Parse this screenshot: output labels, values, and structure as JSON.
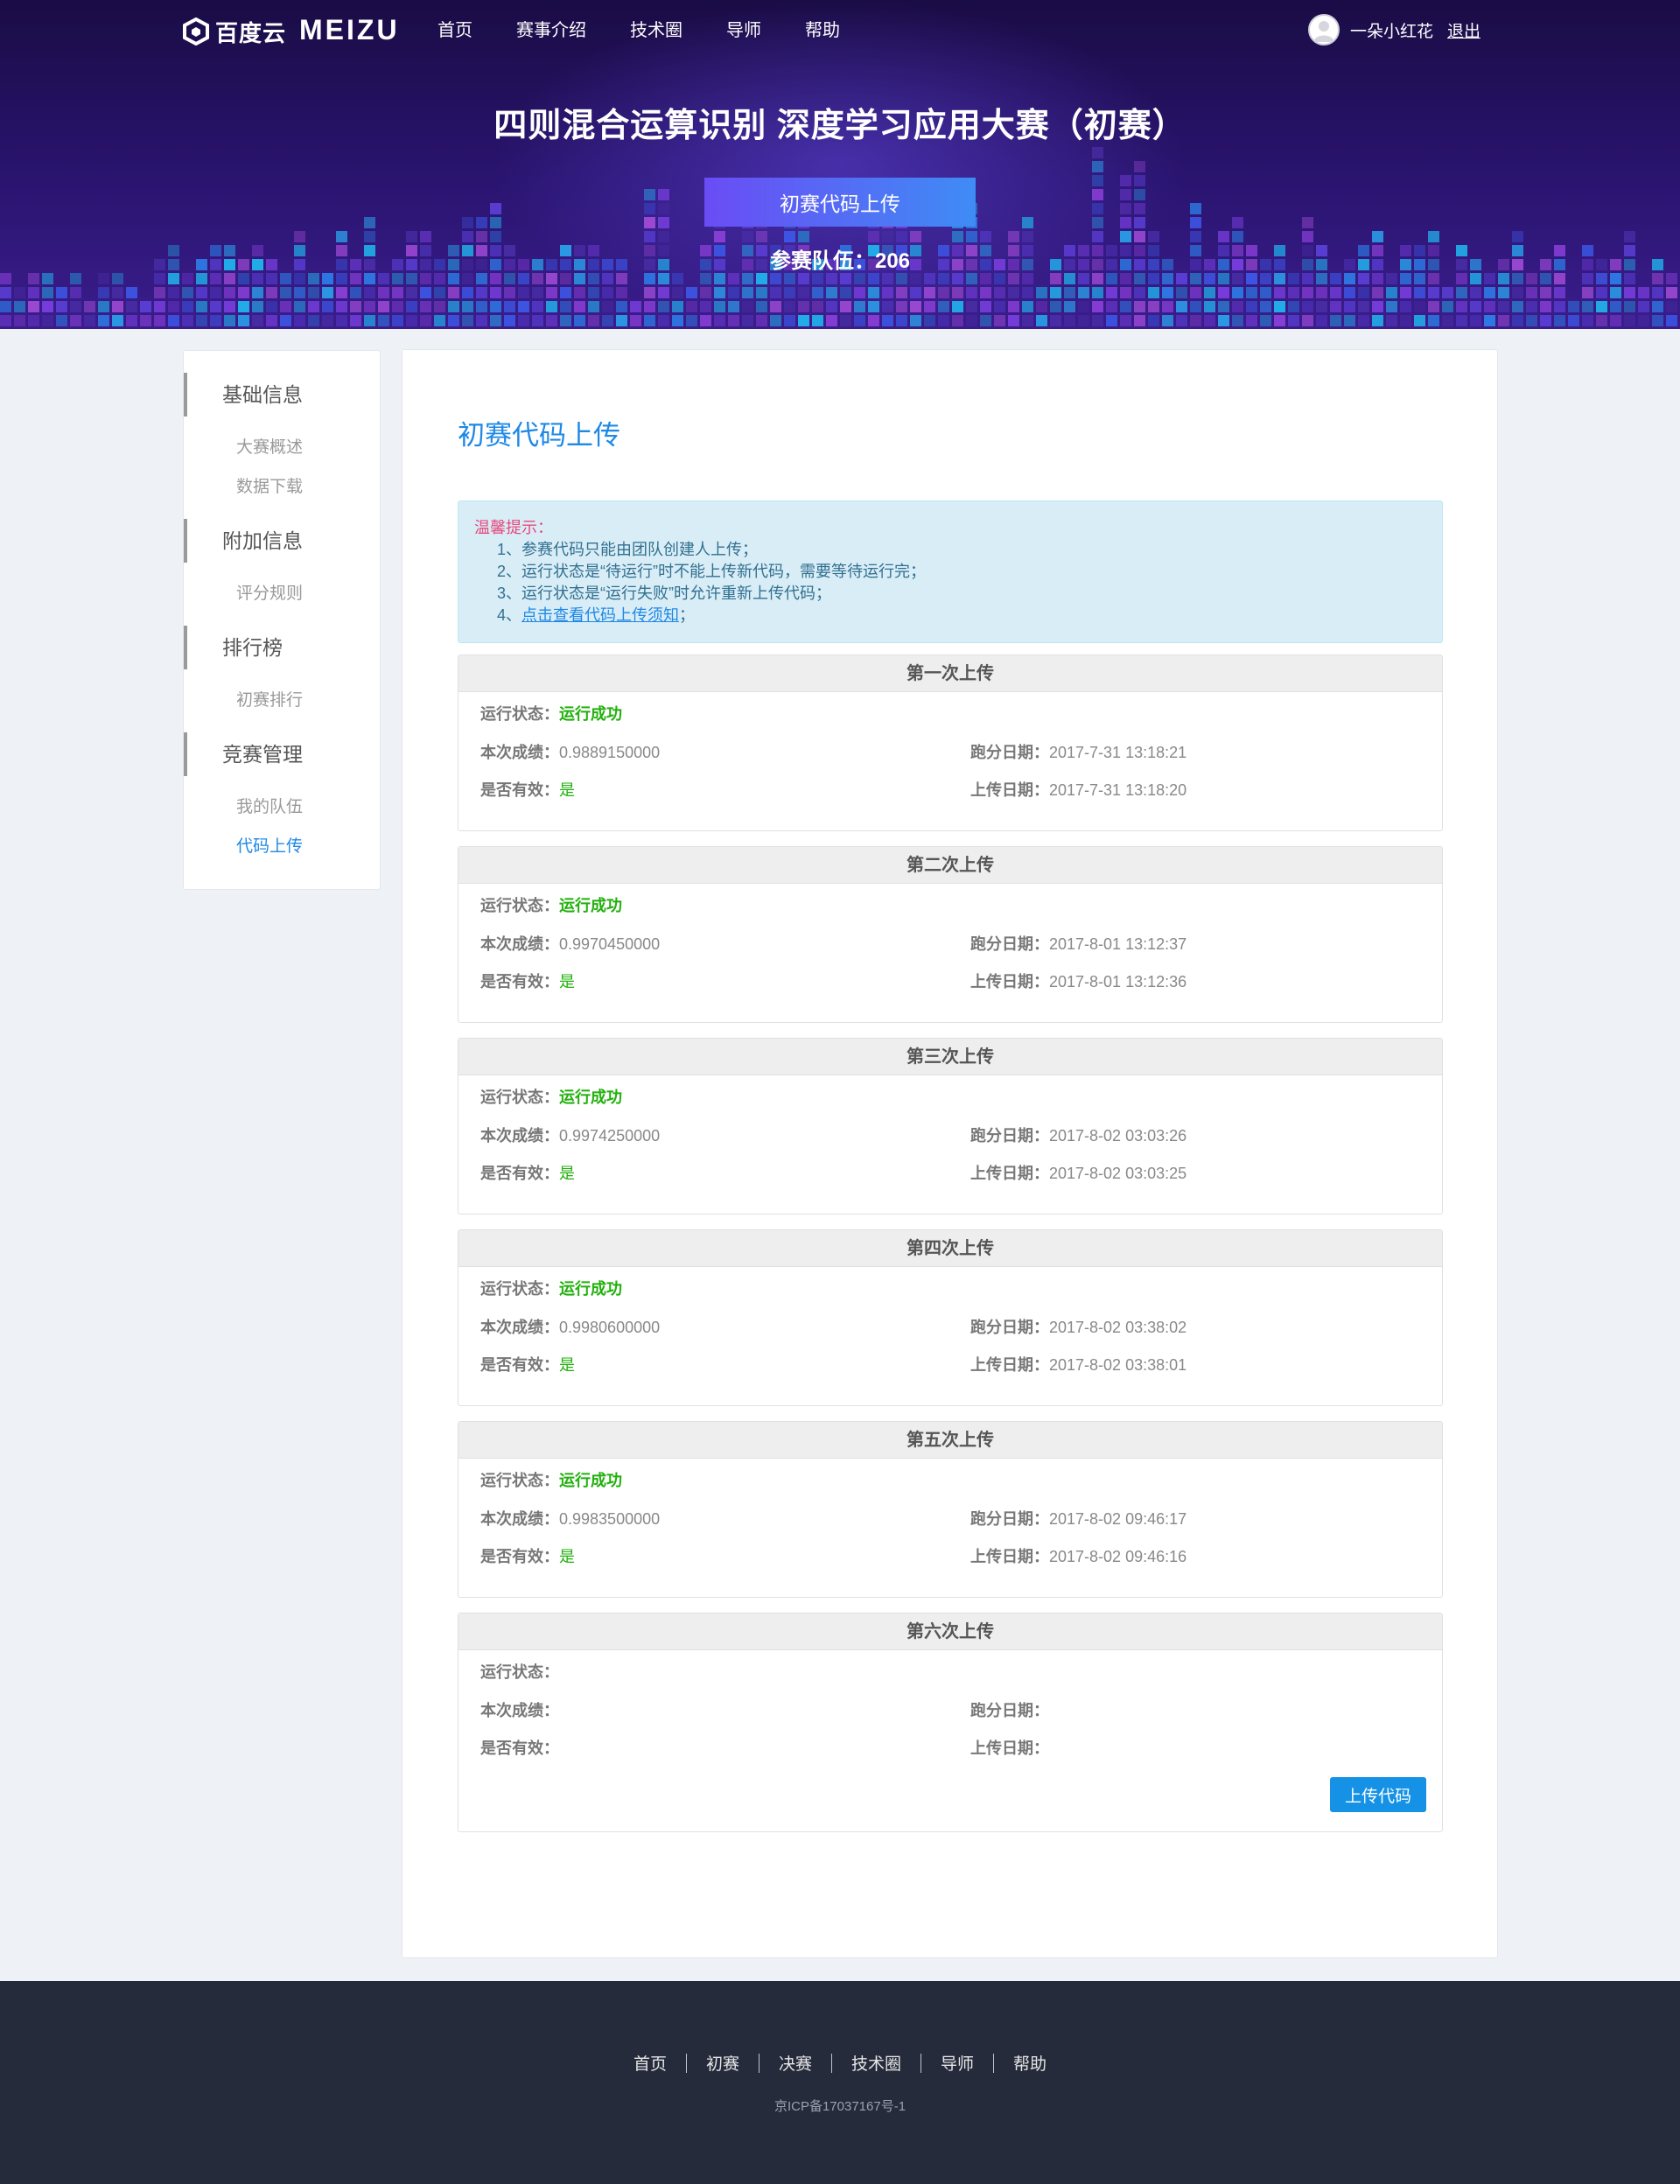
{
  "header": {
    "logo_baidu": "百度云",
    "logo_meizu": "MEIZU",
    "nav": [
      "首页",
      "赛事介绍",
      "技术圈",
      "导师",
      "帮助"
    ],
    "user_name": "一朵小红花",
    "logout": "退出"
  },
  "hero": {
    "title": "四则混合运算识别 深度学习应用大赛（初赛）",
    "button": "初赛代码上传",
    "team_count": "参赛队伍：206"
  },
  "sidebar": {
    "groups": [
      {
        "heading": "基础信息",
        "items": [
          "大赛概述",
          "数据下载"
        ]
      },
      {
        "heading": "附加信息",
        "items": [
          "评分规则"
        ]
      },
      {
        "heading": "排行榜",
        "items": [
          "初赛排行"
        ]
      },
      {
        "heading": "竞赛管理",
        "items": [
          "我的队伍",
          "代码上传"
        ]
      }
    ],
    "active_item": "代码上传"
  },
  "main": {
    "title": "初赛代码上传",
    "tips": {
      "title": "温馨提示：",
      "items": [
        "1、参赛代码只能由团队创建人上传；",
        "2、运行状态是“待运行”时不能上传新代码，需要等待运行完；",
        "3、运行状态是“运行失败”时允许重新上传代码；"
      ],
      "link_prefix": "4、",
      "link_text": "点击查看代码上传须知",
      "link_suffix": "；"
    },
    "labels": {
      "status": "运行状态：",
      "score": "本次成绩：",
      "valid": "是否有效：",
      "run_date": "跑分日期：",
      "upload_date": "上传日期："
    },
    "uploads": [
      {
        "title": "第一次上传",
        "status": "运行成功",
        "score": "0.9889150000",
        "valid": "是",
        "run_date": "2017-7-31 13:18:21",
        "upload_date": "2017-7-31 13:18:20"
      },
      {
        "title": "第二次上传",
        "status": "运行成功",
        "score": "0.9970450000",
        "valid": "是",
        "run_date": "2017-8-01 13:12:37",
        "upload_date": "2017-8-01 13:12:36"
      },
      {
        "title": "第三次上传",
        "status": "运行成功",
        "score": "0.9974250000",
        "valid": "是",
        "run_date": "2017-8-02 03:03:26",
        "upload_date": "2017-8-02 03:03:25"
      },
      {
        "title": "第四次上传",
        "status": "运行成功",
        "score": "0.9980600000",
        "valid": "是",
        "run_date": "2017-8-02 03:38:02",
        "upload_date": "2017-8-02 03:38:01"
      },
      {
        "title": "第五次上传",
        "status": "运行成功",
        "score": "0.9983500000",
        "valid": "是",
        "run_date": "2017-8-02 09:46:17",
        "upload_date": "2017-8-02 09:46:16"
      },
      {
        "title": "第六次上传",
        "status": "",
        "score": "",
        "valid": "",
        "run_date": "",
        "upload_date": ""
      }
    ],
    "upload_button": "上传代码"
  },
  "footer": {
    "links": [
      "首页",
      "初赛",
      "决赛",
      "技术圈",
      "导师",
      "帮助"
    ],
    "icp": "京ICP备17037167号-1"
  },
  "colors": {
    "accent": "#1e88e5",
    "success": "#22b00d",
    "tip_title": "#e64a7d",
    "footer_bg": "#262b3c"
  },
  "icons": [
    "baidu-cloud-logo-icon",
    "avatar-icon"
  ]
}
